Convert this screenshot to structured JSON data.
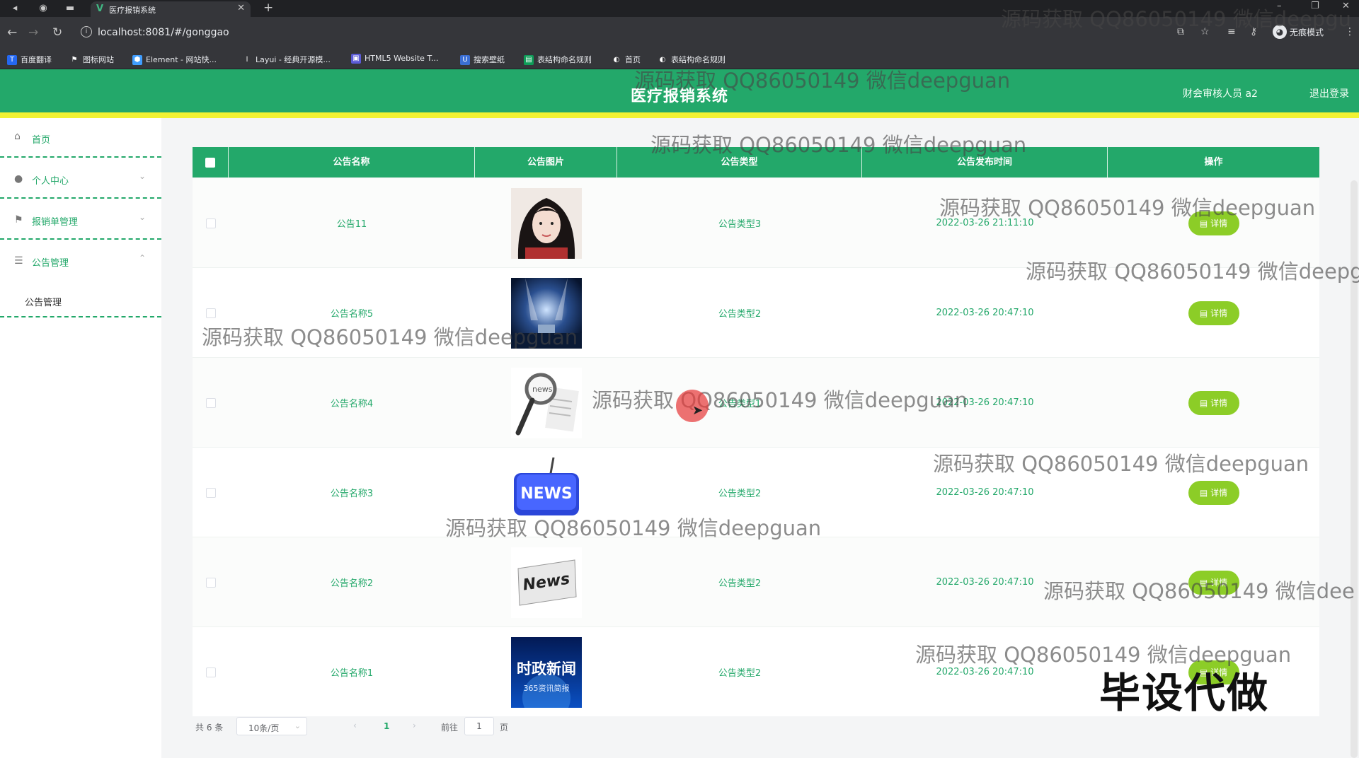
{
  "browser": {
    "tab_title": "医疗报销系统",
    "url": "localhost:8081/#/gonggao",
    "profile_label": "无痕模式",
    "bookmarks": [
      {
        "label": "百度翻译",
        "color": "#2468f2",
        "glyph": "T"
      },
      {
        "label": "图标网站",
        "color": "#35363a",
        "glyph": "⚑"
      },
      {
        "label": "Element - 网站快...",
        "color": "#409eff",
        "glyph": "⬢"
      },
      {
        "label": "Layui - 经典开源模...",
        "color": "#35363a",
        "glyph": "l"
      },
      {
        "label": "HTML5 Website T...",
        "color": "#5b5bd6",
        "glyph": "▣"
      },
      {
        "label": "搜索壁纸",
        "color": "#3b6fd4",
        "glyph": "U"
      },
      {
        "label": "表结构命名规则",
        "color": "#0f9d58",
        "glyph": "▤"
      },
      {
        "label": "首页",
        "color": "#35363a",
        "glyph": "◐"
      },
      {
        "label": "表结构命名规则",
        "color": "#35363a",
        "glyph": "◐"
      }
    ]
  },
  "header": {
    "title": "医疗报销系统",
    "user_label": "财会审核人员 a2",
    "logout_label": "退出登录"
  },
  "sidebar": {
    "items": [
      {
        "label": "首页",
        "icon": "home-icon"
      },
      {
        "label": "个人中心",
        "icon": "user-icon"
      },
      {
        "label": "报销单管理",
        "icon": "flag-icon"
      },
      {
        "label": "公告管理",
        "icon": "sliders-icon"
      }
    ],
    "sub_item": "公告管理"
  },
  "table": {
    "columns": [
      "公告名称",
      "公告图片",
      "公告类型",
      "公告发布时间",
      "操作"
    ],
    "detail_label": "详情",
    "rows": [
      {
        "name": "公告11",
        "image": "portrait",
        "type": "公告类型3",
        "time": "2022-03-26 21:11:10"
      },
      {
        "name": "公告名称5",
        "image": "stage",
        "type": "公告类型2",
        "time": "2022-03-26 20:47:10"
      },
      {
        "name": "公告名称4",
        "image": "magnifier",
        "type": "公告类型1",
        "time": "2022-03-26 20:47:10"
      },
      {
        "name": "公告名称3",
        "image": "news-key",
        "type": "公告类型2",
        "time": "2022-03-26 20:47:10"
      },
      {
        "name": "公告名称2",
        "image": "news-paper",
        "type": "公告类型2",
        "time": "2022-03-26 20:47:10"
      },
      {
        "name": "公告名称1",
        "image": "politics-news",
        "type": "公告类型2",
        "time": "2022-03-26 20:47:10"
      }
    ]
  },
  "image_text": {
    "news": "NEWS",
    "news_paper": "News",
    "politics_title": "时政新闻",
    "politics_sub": "365资讯简报"
  },
  "pagination": {
    "total": "共 6 条",
    "page_size": "10条/页",
    "current_page": "1",
    "goto_label": "前往",
    "goto_value": "1",
    "page_suffix": "页"
  },
  "overlay": {
    "watermark": "源码获取 QQ86050149 微信deepguan",
    "watermark_truncated_1": "源码获取 QQ86050149 微信deepgu",
    "watermark_truncated_2": "源码获取 QQ86050149 微信deepg",
    "watermark_truncated_3": "源码获取 QQ86050149 微信dee",
    "stamp": "毕设代做"
  }
}
